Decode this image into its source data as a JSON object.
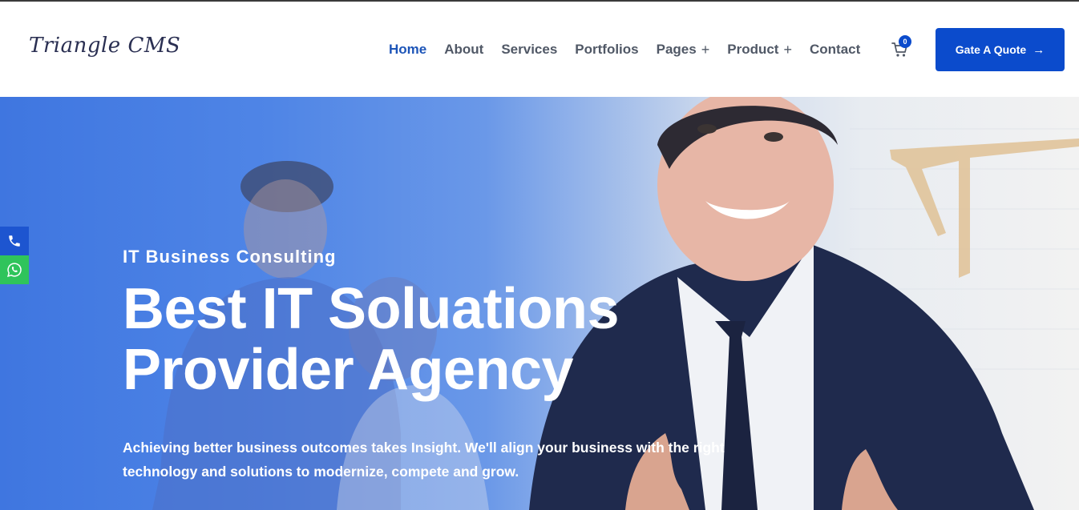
{
  "header": {
    "logo": "Triangle CMS",
    "nav": [
      {
        "label": "Home",
        "active": true
      },
      {
        "label": "About"
      },
      {
        "label": "Services"
      },
      {
        "label": "Portfolios"
      },
      {
        "label": "Pages",
        "expandable": true
      },
      {
        "label": "Product",
        "expandable": true
      },
      {
        "label": "Contact"
      }
    ],
    "cart_count": "0",
    "cta_label": "Gate A Quote",
    "cta_icon": "arrow-right-icon"
  },
  "hero": {
    "kicker": "IT Business Consulting",
    "headline_line1": "Best IT Soluations",
    "headline_line2": "Provider Agency",
    "description": "Achieving better business outcomes takes Insight. We'll align your business with the right technology and solutions to modernize, compete and grow."
  },
  "side_contacts": {
    "phone_icon": "phone-icon",
    "whatsapp_icon": "whatsapp-icon"
  },
  "colors": {
    "brand_blue": "#0b4bcc",
    "active_nav": "#1d55b8",
    "whatsapp_green": "#2fc45b",
    "hero_overlay": "#3f76e0"
  }
}
